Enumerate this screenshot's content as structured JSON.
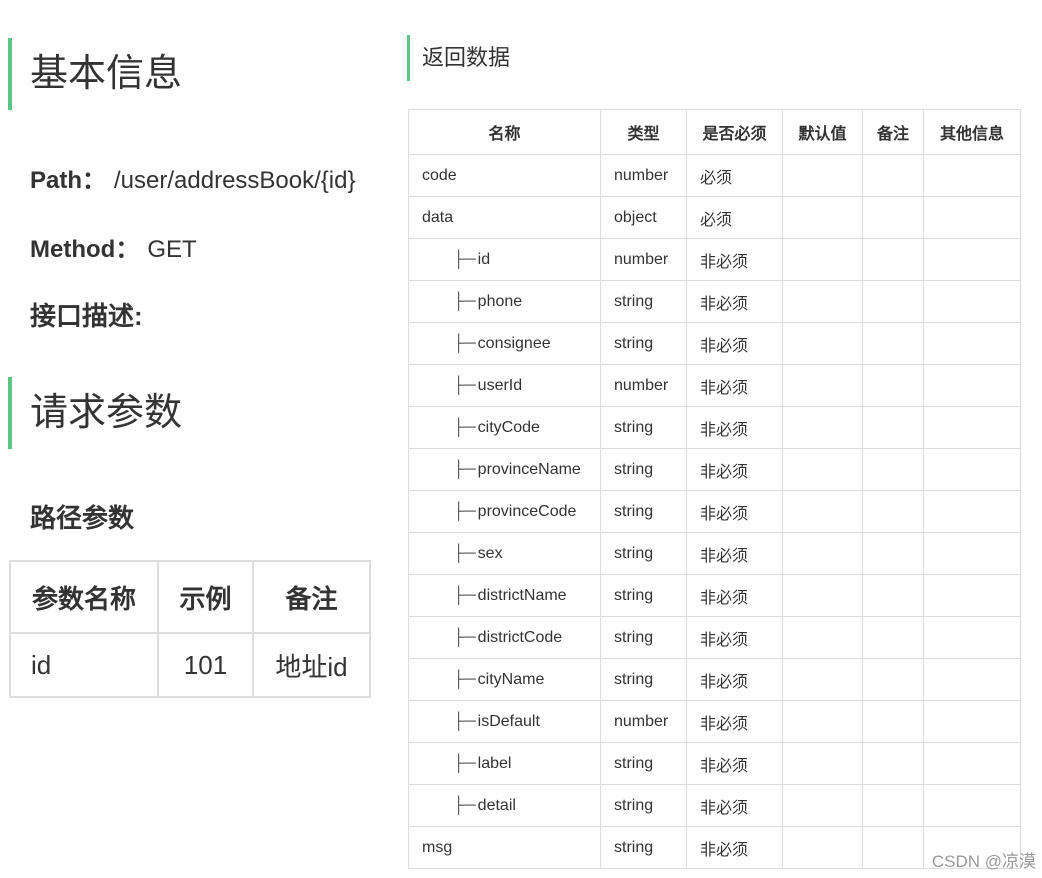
{
  "basic": {
    "title": "基本信息",
    "path_label": "Path：",
    "path_value": "/user/addressBook/{id}",
    "method_label": "Method：",
    "method_value": "GET",
    "desc_label": "接口描述:"
  },
  "request": {
    "title": "请求参数",
    "path_params_title": "路径参数",
    "headers": [
      "参数名称",
      "示例",
      "备注"
    ],
    "rows": [
      [
        "id",
        "101",
        "地址id"
      ]
    ]
  },
  "response": {
    "title": "返回数据",
    "headers": [
      "名称",
      "类型",
      "是否必须",
      "默认值",
      "备注",
      "其他信息"
    ],
    "tree_glyph": "├─",
    "rows": [
      {
        "name": "code",
        "type": "number",
        "required": "必须",
        "child": false
      },
      {
        "name": "data",
        "type": "object",
        "required": "必须",
        "child": false
      },
      {
        "name": "id",
        "type": "number",
        "required": "非必须",
        "child": true
      },
      {
        "name": "phone",
        "type": "string",
        "required": "非必须",
        "child": true
      },
      {
        "name": "consignee",
        "type": "string",
        "required": "非必须",
        "child": true
      },
      {
        "name": "userId",
        "type": "number",
        "required": "非必须",
        "child": true
      },
      {
        "name": "cityCode",
        "type": "string",
        "required": "非必须",
        "child": true
      },
      {
        "name": "provinceName",
        "type": "string",
        "required": "非必须",
        "child": true
      },
      {
        "name": "provinceCode",
        "type": "string",
        "required": "非必须",
        "child": true
      },
      {
        "name": "sex",
        "type": "string",
        "required": "非必须",
        "child": true
      },
      {
        "name": "districtName",
        "type": "string",
        "required": "非必须",
        "child": true
      },
      {
        "name": "districtCode",
        "type": "string",
        "required": "非必须",
        "child": true
      },
      {
        "name": "cityName",
        "type": "string",
        "required": "非必须",
        "child": true
      },
      {
        "name": "isDefault",
        "type": "number",
        "required": "非必须",
        "child": true
      },
      {
        "name": "label",
        "type": "string",
        "required": "非必须",
        "child": true
      },
      {
        "name": "detail",
        "type": "string",
        "required": "非必须",
        "child": true
      },
      {
        "name": "msg",
        "type": "string",
        "required": "非必须",
        "child": false
      }
    ]
  },
  "watermark": "CSDN @凉漠",
  "colors": {
    "accent": "#5fc587",
    "border": "#dddddd",
    "text": "#333333"
  }
}
